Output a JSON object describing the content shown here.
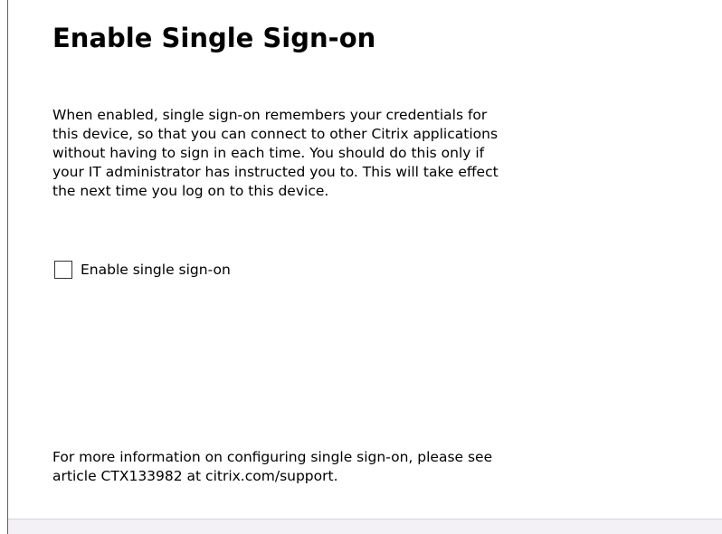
{
  "dialog": {
    "title": "Enable Single Sign-on",
    "description_lines": [
      "When enabled, single sign-on remembers your credentials for",
      "this device, so that you can connect to other Citrix applications",
      "without having to sign in each time. You should do this only if",
      "your IT administrator has instructed you to. This will take effect",
      "the next time you log on to this device."
    ],
    "checkbox": {
      "label": "Enable single sign-on",
      "checked": false
    },
    "info_lines": [
      "For more information on configuring single sign-on, please see",
      "article CTX133982 at citrix.com/support."
    ]
  }
}
